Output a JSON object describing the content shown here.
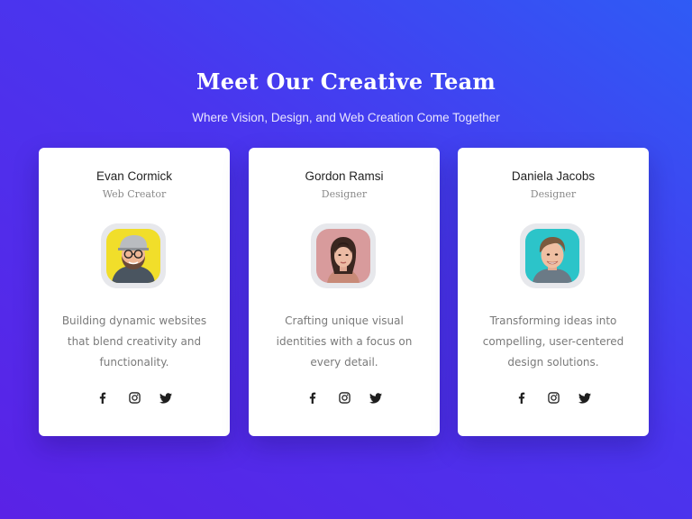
{
  "header": {
    "title": "Meet Our Creative Team",
    "subtitle": "Where Vision, Design, and Web Creation Come Together"
  },
  "colors": {
    "background_start": "#2f5bf5",
    "background_end": "#5a22e6",
    "card_background": "#ffffff",
    "text_primary": "#222222",
    "text_secondary": "#7a7a7a"
  },
  "team": [
    {
      "name": "Evan Cormick",
      "role": "Web Creator",
      "description": "Building dynamic websites that blend creativity and functionality.",
      "avatar_bg": "#f1de2a",
      "social_icons": [
        "facebook-icon",
        "instagram-icon",
        "twitter-icon"
      ]
    },
    {
      "name": "Gordon Ramsi",
      "role": "Designer",
      "description": "Crafting unique visual identities with a focus on every detail.",
      "avatar_bg": "#d89b9c",
      "social_icons": [
        "facebook-icon",
        "instagram-icon",
        "twitter-icon"
      ]
    },
    {
      "name": "Daniela Jacobs",
      "role": "Designer",
      "description": "Transforming ideas into compelling, user-centered design solutions.",
      "avatar_bg": "#2cc4c9",
      "social_icons": [
        "facebook-icon",
        "instagram-icon",
        "twitter-icon"
      ]
    }
  ]
}
